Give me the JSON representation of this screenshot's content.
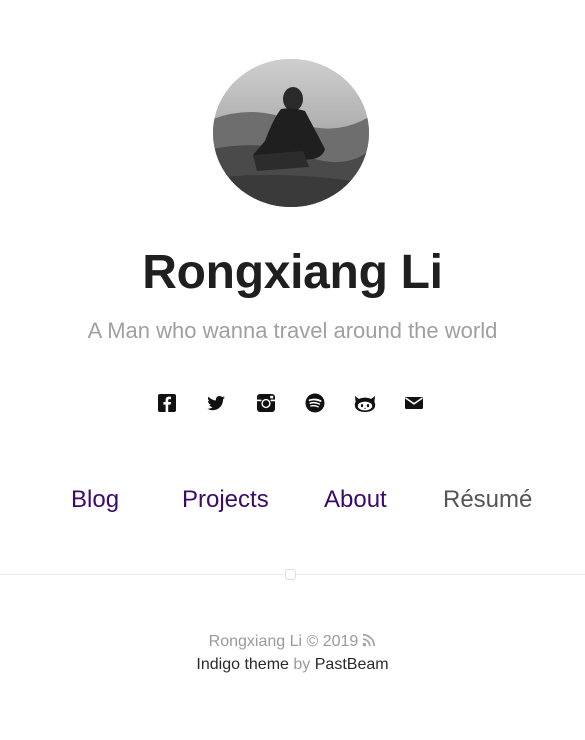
{
  "profile": {
    "name": "Rongxiang Li",
    "tagline": "A Man who wanna travel around the world",
    "avatar_alt": "profile photo"
  },
  "social": [
    {
      "icon": "facebook-icon"
    },
    {
      "icon": "twitter-icon"
    },
    {
      "icon": "instagram-icon"
    },
    {
      "icon": "spotify-icon"
    },
    {
      "icon": "github-icon"
    },
    {
      "icon": "email-icon"
    }
  ],
  "nav": {
    "blog": "Blog",
    "projects": "Projects",
    "about": "About",
    "resume": "Résumé"
  },
  "footer": {
    "copyright": "Rongxiang Li © 2019",
    "theme_name": "Indigo theme",
    "by": "by",
    "author": "PastBeam",
    "rss_icon": "rss-icon"
  },
  "colors": {
    "nav_link": "#3c0a6b",
    "name": "#1f1f1f",
    "muted": "#a0a0a0"
  }
}
